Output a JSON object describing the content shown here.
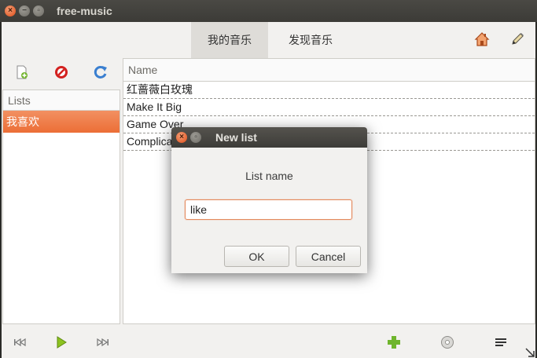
{
  "app": {
    "window_title": "free-music",
    "window_controls": [
      "close",
      "minimize",
      "maximize"
    ]
  },
  "topbar": {
    "tabs": [
      {
        "label": "我的音乐",
        "active": true
      },
      {
        "label": "发现音乐",
        "active": false
      }
    ],
    "actions": [
      "home-icon",
      "pencil-icon"
    ]
  },
  "sidebar": {
    "tools": [
      "new-file-icon",
      "delete-icon",
      "refresh-icon"
    ],
    "lists_header": "Lists",
    "lists": [
      {
        "label": "我喜欢",
        "selected": true
      }
    ]
  },
  "songs": {
    "column_header": "Name",
    "rows": [
      "红蔷薇白玫瑰",
      "Make It Big",
      "Game Over",
      "Complicated"
    ]
  },
  "bottombar": {
    "controls": [
      "previous-icon",
      "play-icon",
      "next-icon",
      "add-icon",
      "disc-icon",
      "menu-icon"
    ]
  },
  "dialog": {
    "title": "New list",
    "prompt": "List name",
    "input_value": "like",
    "ok_label": "OK",
    "cancel_label": "Cancel"
  },
  "colors": {
    "accent": "#ec6e36",
    "titlebar": "#3c3b37",
    "window_bg": "#f2f1ef",
    "play_green": "#7ab317"
  }
}
